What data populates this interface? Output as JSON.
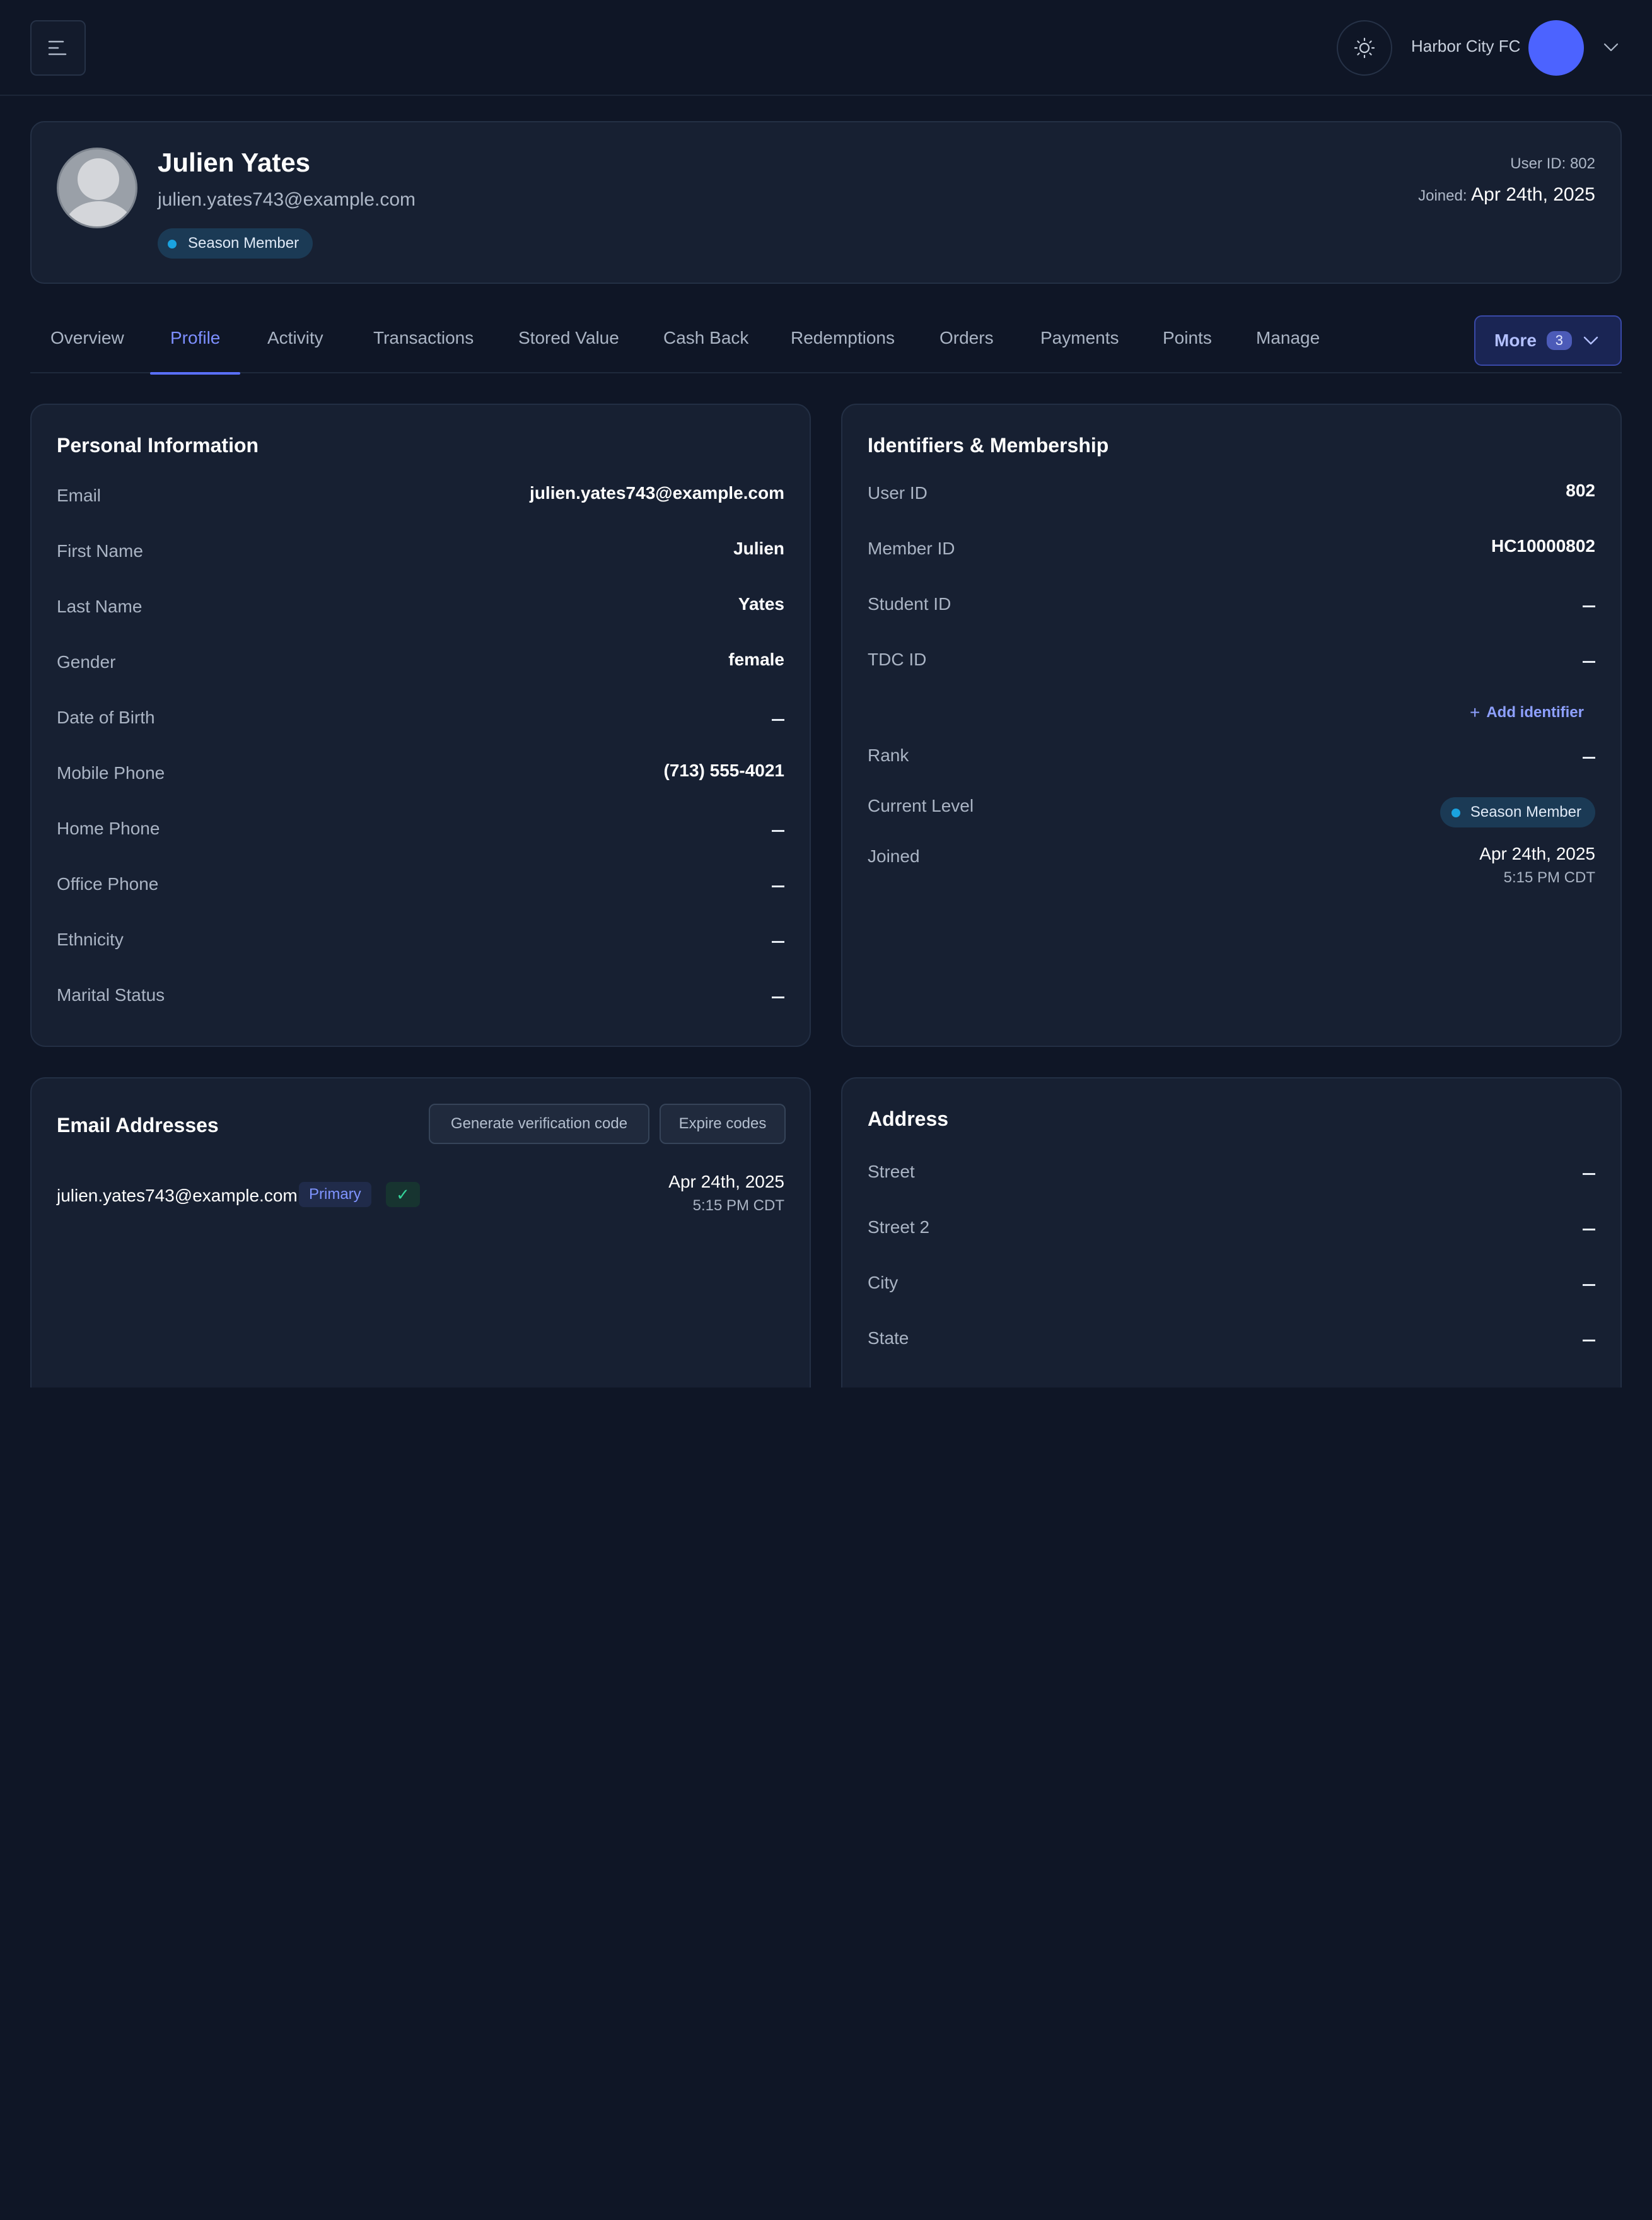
{
  "topbar": {
    "org_name": "Harbor City FC"
  },
  "member": {
    "name": "Julien Yates",
    "email": "julien.yates743@example.com",
    "level": "Season Member",
    "user_id_text": "User ID: 802",
    "joined_label": "Joined:",
    "joined_date": "Apr 24th, 2025"
  },
  "tabs": [
    {
      "label": "Overview",
      "active": false
    },
    {
      "label": "Profile",
      "active": true
    },
    {
      "label": "Activity",
      "active": false
    },
    {
      "label": "Transactions",
      "active": false
    },
    {
      "label": "Stored Value",
      "active": false
    },
    {
      "label": "Cash Back",
      "active": false
    },
    {
      "label": "Redemptions",
      "active": false
    },
    {
      "label": "Orders",
      "active": false
    },
    {
      "label": "Payments",
      "active": false
    },
    {
      "label": "Points",
      "active": false
    },
    {
      "label": "Manage",
      "active": false
    }
  ],
  "more": {
    "label": "More",
    "count": "3"
  },
  "personal": {
    "title": "Personal Information",
    "rows": [
      {
        "label": "Email",
        "value": "julien.yates743@example.com"
      },
      {
        "label": "First Name",
        "value": "Julien"
      },
      {
        "label": "Last Name",
        "value": "Yates"
      },
      {
        "label": "Gender",
        "value": "female"
      },
      {
        "label": "Date of Birth",
        "value": ""
      },
      {
        "label": "Mobile Phone",
        "value": "(713) 555-4021"
      },
      {
        "label": "Home Phone",
        "value": ""
      },
      {
        "label": "Office Phone",
        "value": ""
      },
      {
        "label": "Ethnicity",
        "value": ""
      },
      {
        "label": "Marital Status",
        "value": ""
      }
    ]
  },
  "identifiers": {
    "title": "Identifiers & Membership",
    "rows": [
      {
        "label": "User ID",
        "value": "802"
      },
      {
        "label": "Member ID",
        "value": "HC10000802"
      },
      {
        "label": "Student ID",
        "value": ""
      },
      {
        "label": "TDC ID",
        "value": ""
      }
    ],
    "add_identifier": "Add identifier",
    "rank_label": "Rank",
    "rank_value": "",
    "current_level_label": "Current Level",
    "current_level_value": "Season Member",
    "joined_label": "Joined",
    "joined_date": "Apr 24th, 2025",
    "joined_time": "5:15 PM CDT"
  },
  "emails": {
    "title": "Email Addresses",
    "generate_btn": "Generate verification code",
    "expire_btn": "Expire codes",
    "items": [
      {
        "email": "julien.yates743@example.com",
        "badge": "Primary",
        "verified": "✓",
        "date": "Apr 24th, 2025",
        "time": "5:15 PM CDT"
      }
    ]
  },
  "address": {
    "title": "Address",
    "rows": [
      {
        "label": "Street",
        "value": ""
      },
      {
        "label": "Street 2",
        "value": ""
      },
      {
        "label": "City",
        "value": ""
      },
      {
        "label": "State",
        "value": ""
      }
    ]
  }
}
